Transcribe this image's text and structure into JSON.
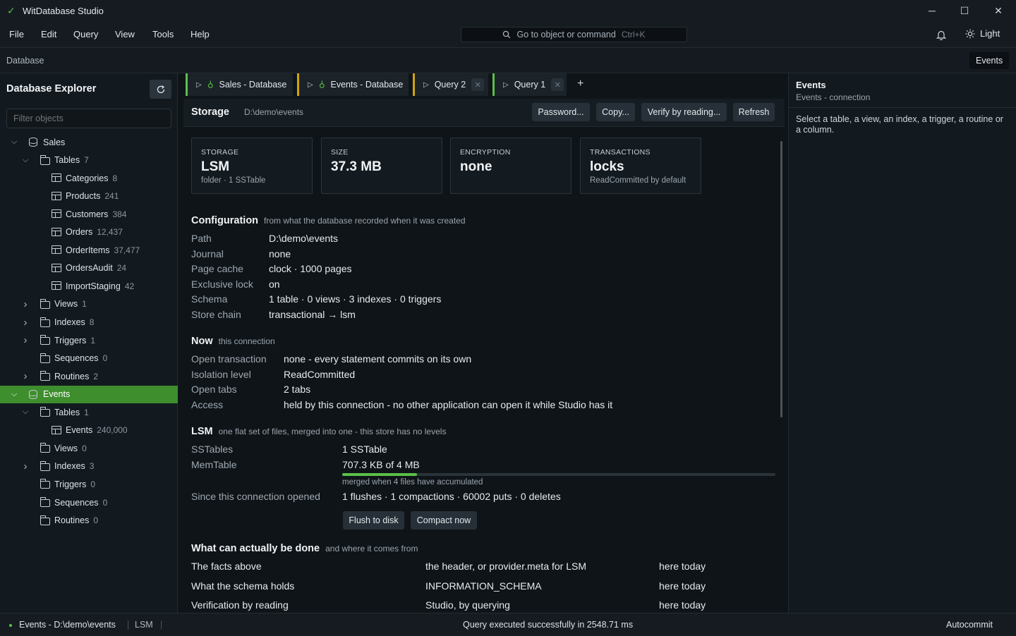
{
  "window": {
    "title": "WitDatabase Studio",
    "minimize": "─",
    "maximize": "☐",
    "close": "✕"
  },
  "menu": [
    "File",
    "Edit",
    "Query",
    "View",
    "Tools",
    "Help"
  ],
  "command_bar": {
    "label": "Go to object or command",
    "shortcut": "Ctrl+K"
  },
  "theme_toggle": "Light",
  "breadcrumb": "Database",
  "breadcrumb_right": "Events",
  "explorer": {
    "title": "Database Explorer",
    "filter_placeholder": "Filter objects",
    "rows": [
      {
        "label": "Sales",
        "count": "",
        "level": 0,
        "icon": "db",
        "chev": "open"
      },
      {
        "label": "Tables",
        "count": "7",
        "level": 1,
        "icon": "folder",
        "chev": "open"
      },
      {
        "label": "Categories",
        "count": "8",
        "level": 2,
        "icon": "table",
        "chev": ""
      },
      {
        "label": "Products",
        "count": "241",
        "level": 2,
        "icon": "table",
        "chev": ""
      },
      {
        "label": "Customers",
        "count": "384",
        "level": 2,
        "icon": "table",
        "chev": ""
      },
      {
        "label": "Orders",
        "count": "12,437",
        "level": 2,
        "icon": "table",
        "chev": ""
      },
      {
        "label": "OrderItems",
        "count": "37,477",
        "level": 2,
        "icon": "table",
        "chev": ""
      },
      {
        "label": "OrdersAudit",
        "count": "24",
        "level": 2,
        "icon": "table",
        "chev": ""
      },
      {
        "label": "ImportStaging",
        "count": "42",
        "level": 2,
        "icon": "table",
        "chev": ""
      },
      {
        "label": "Views",
        "count": "1",
        "level": 1,
        "icon": "folder",
        "chev": "closed"
      },
      {
        "label": "Indexes",
        "count": "8",
        "level": 1,
        "icon": "folder",
        "chev": "closed"
      },
      {
        "label": "Triggers",
        "count": "1",
        "level": 1,
        "icon": "folder",
        "chev": "closed"
      },
      {
        "label": "Sequences",
        "count": "0",
        "level": 1,
        "icon": "folder",
        "chev": ""
      },
      {
        "label": "Routines",
        "count": "2",
        "level": 1,
        "icon": "folder",
        "chev": "closed"
      },
      {
        "label": "Events",
        "count": "",
        "level": 0,
        "icon": "db",
        "chev": "open",
        "selected": true
      },
      {
        "label": "Tables",
        "count": "1",
        "level": 1,
        "icon": "folder",
        "chev": "open"
      },
      {
        "label": "Events",
        "count": "240,000",
        "level": 2,
        "icon": "table",
        "chev": ""
      },
      {
        "label": "Views",
        "count": "0",
        "level": 1,
        "icon": "folder",
        "chev": ""
      },
      {
        "label": "Indexes",
        "count": "3",
        "level": 1,
        "icon": "folder",
        "chev": "closed"
      },
      {
        "label": "Triggers",
        "count": "0",
        "level": 1,
        "icon": "folder",
        "chev": ""
      },
      {
        "label": "Sequences",
        "count": "0",
        "level": 1,
        "icon": "folder",
        "chev": ""
      },
      {
        "label": "Routines",
        "count": "0",
        "level": 1,
        "icon": "folder",
        "chev": ""
      }
    ]
  },
  "tabs": [
    {
      "label": "Sales - Database",
      "accent": "#5bc04a",
      "db": true,
      "closable": false
    },
    {
      "label": "Events - Database",
      "accent": "#d1a30f",
      "db": true,
      "closable": false
    },
    {
      "label": "Query 2",
      "accent": "#d1a30f",
      "db": false,
      "closable": true
    },
    {
      "label": "Query 1",
      "accent": "#5bc04a",
      "db": false,
      "closable": true
    }
  ],
  "add_tab": "+",
  "storage": {
    "title": "Storage",
    "path": "D:\\demo\\events",
    "buttons": [
      "Password...",
      "Copy...",
      "Verify by reading...",
      "Refresh"
    ],
    "cards": [
      {
        "k": "STORAGE",
        "v": "LSM",
        "s": "folder · 1 SSTable"
      },
      {
        "k": "SIZE",
        "v": "37.3 MB",
        "s": ""
      },
      {
        "k": "ENCRYPTION",
        "v": "none",
        "s": ""
      },
      {
        "k": "TRANSACTIONS",
        "v": "locks",
        "s": "ReadCommitted by default"
      }
    ],
    "configuration": {
      "title": "Configuration",
      "subtitle": "from what the database recorded when it was created",
      "rows": [
        {
          "k": "Path",
          "v": "D:\\demo\\events"
        },
        {
          "k": "Journal",
          "v": "none"
        },
        {
          "k": "Page cache",
          "v": "clock · 1000 pages"
        },
        {
          "k": "Exclusive lock",
          "v": "on"
        },
        {
          "k": "Schema",
          "v": "1 table · 0 views · 3 indexes · 0 triggers"
        },
        {
          "k": "Store chain",
          "v": "transactional → lsm"
        }
      ]
    },
    "now": {
      "title": "Now",
      "subtitle": "this connection",
      "rows": [
        {
          "k": "Open transaction",
          "v": "none - every statement commits on its own"
        },
        {
          "k": "Isolation level",
          "v": "ReadCommitted"
        },
        {
          "k": "Open tabs",
          "v": "2 tabs"
        },
        {
          "k": "Access",
          "v": "held by this connection - no other application can open it while Studio has it"
        }
      ]
    },
    "lsm": {
      "title": "LSM",
      "subtitle": "one flat set of files, merged into one - this store has no levels",
      "sstables_k": "SSTables",
      "sstables_v": "1 SSTable",
      "memtable_k": "MemTable",
      "memtable_v": "707.3 KB of 4 MB",
      "memtable_fraction": 0.173,
      "merge_note": "merged when 4 files have accumulated",
      "since_k": "Since this connection opened",
      "since_v": "1 flushes · 1 compactions · 60002 puts · 0 deletes",
      "flush_btn": "Flush to disk",
      "compact_btn": "Compact now"
    },
    "capabilities": {
      "title": "What can actually be done",
      "subtitle": "and where it comes from",
      "rows": [
        {
          "a": "The facts above",
          "b": "the header, or provider.meta for LSM",
          "c": "here today"
        },
        {
          "a": "What the schema holds",
          "b": "INFORMATION_SCHEMA",
          "c": "here today"
        },
        {
          "a": "Verification by reading",
          "b": "Studio, by querying",
          "c": "here today"
        }
      ]
    }
  },
  "right_panel": {
    "title": "Events",
    "subtitle": "Events - connection",
    "hint": "Select a table, a view, an index, a trigger, a routine or a column."
  },
  "status": {
    "connection": "Events - D:\\demo\\events",
    "engine": "LSM",
    "message": "Query executed successfully in 2548.71 ms",
    "mode": "Autocommit"
  },
  "colors": {
    "accent_green": "#5bc04a",
    "accent_yellow": "#d1a30f",
    "selection": "#3e8e2e"
  }
}
